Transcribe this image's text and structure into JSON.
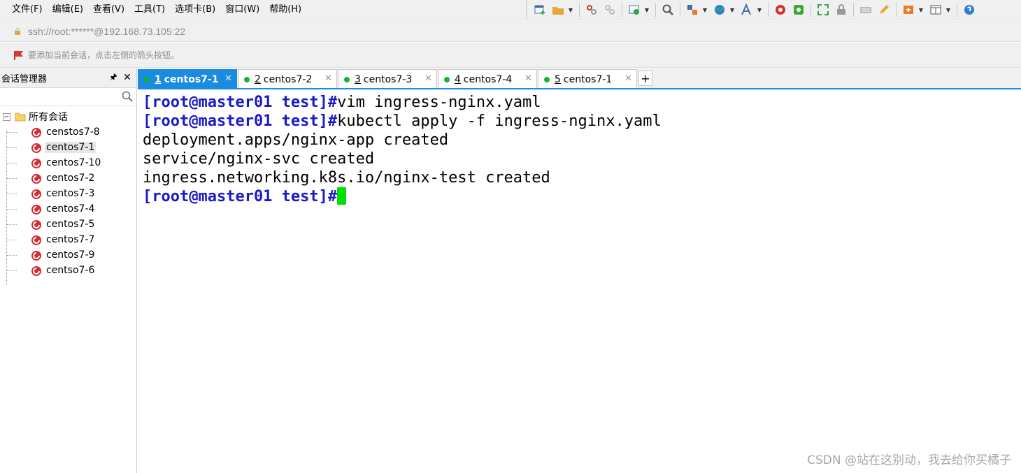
{
  "menu": [
    "文件(F)",
    "编辑(E)",
    "查看(V)",
    "工具(T)",
    "选项卡(B)",
    "窗口(W)",
    "帮助(H)"
  ],
  "address": {
    "text": "ssh://root:******@192.168.73.105:22"
  },
  "hint": {
    "text": "要添加当前会话，点击左侧的箭头按钮。"
  },
  "sidebar": {
    "title": "会话管理器",
    "pin_glyph": "🖈",
    "close_glyph": "✕",
    "root_label": "所有会话",
    "expand_glyph": "−",
    "sessions": [
      "censtos7-8",
      "centos7-1",
      "centos7-10",
      "centos7-2",
      "centos7-3",
      "centos7-4",
      "centos7-5",
      "centos7-7",
      "centos7-9",
      "centso7-6"
    ],
    "selected_index": 1
  },
  "tabs": [
    {
      "num": "1",
      "label": "centos7-1",
      "active": true
    },
    {
      "num": "2",
      "label": "centos7-2",
      "active": false
    },
    {
      "num": "3",
      "label": "centos7-3",
      "active": false
    },
    {
      "num": "4",
      "label": "centos7-4",
      "active": false
    },
    {
      "num": "5",
      "label": "centos7-1",
      "active": false
    }
  ],
  "tab_close_glyph": "✕",
  "tab_add_glyph": "+",
  "terminal": {
    "lines": [
      {
        "prompt": "[root@master01 test]#",
        "text": "vim ingress-nginx.yaml"
      },
      {
        "prompt": "[root@master01 test]#",
        "text": "kubectl apply -f ingress-nginx.yaml"
      },
      {
        "prompt": "",
        "text": "deployment.apps/nginx-app created"
      },
      {
        "prompt": "",
        "text": "service/nginx-svc created"
      },
      {
        "prompt": "",
        "text": "ingress.networking.k8s.io/nginx-test created"
      },
      {
        "prompt": "[root@master01 test]#",
        "text": "",
        "cursor": true
      }
    ]
  },
  "watermark": "CSDN @站在这别动，我去给你买橘子",
  "colors": {
    "accent": "#1a8ce0",
    "prompt": "#1a1ac8",
    "cursor": "#00e000",
    "status_dot": "#11b533"
  }
}
